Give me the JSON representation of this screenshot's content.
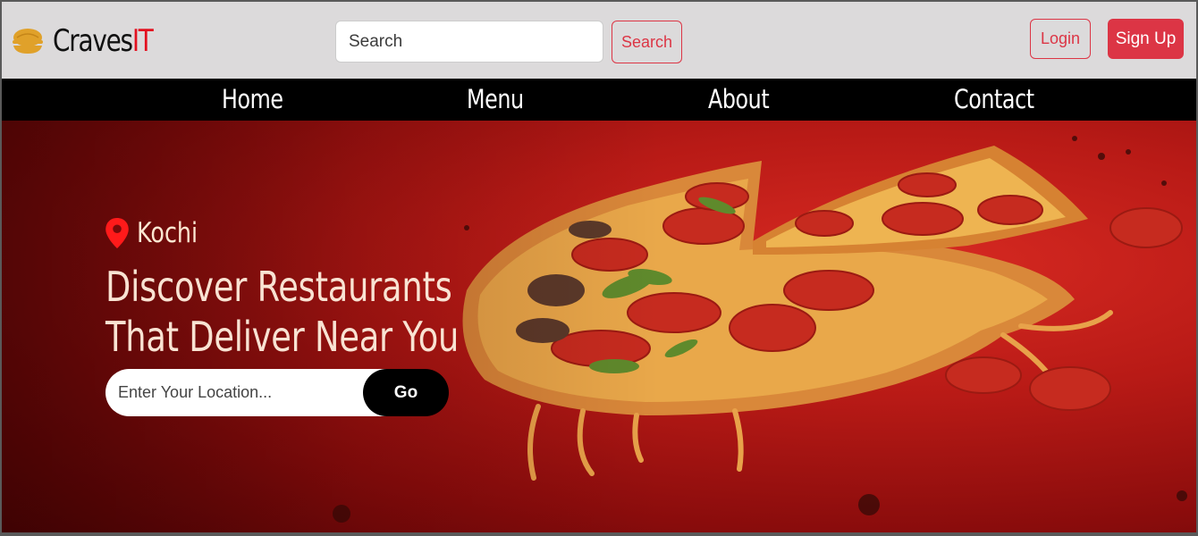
{
  "brand": {
    "name_main": "Craves",
    "name_accent": "IT"
  },
  "header": {
    "search_placeholder": "Search",
    "search_button": "Search",
    "login_button": "Login",
    "signup_button": "Sign Up"
  },
  "nav": {
    "items": [
      "Home",
      "Menu",
      "About",
      "Contact"
    ]
  },
  "hero": {
    "location": "Kochi",
    "headline_line1": "Discover Restaurants",
    "headline_line2": "That Deliver Near You",
    "location_placeholder": "Enter Your Location...",
    "go_button": "Go"
  },
  "colors": {
    "accent": "#dc3545",
    "logo_accent": "#e3101f",
    "logo_icon": "#e0a12a",
    "header_bg": "#dcdadb",
    "nav_bg": "#000000"
  },
  "icons": [
    "food-bowl-icon",
    "map-pin-icon"
  ]
}
